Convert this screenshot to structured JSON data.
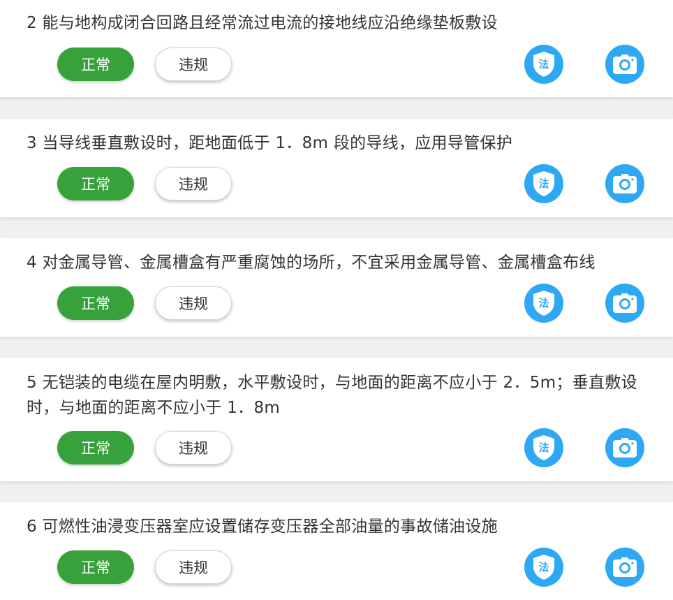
{
  "colors": {
    "normal_button": "#37a23b",
    "icon_button": "#2fa8f3",
    "background": "#f0f0f0"
  },
  "buttons": {
    "normal_label": "正常",
    "violation_label": "违规",
    "law_icon_char": "法"
  },
  "items": [
    {
      "text": "2 能与地构成闭合回路且经常流过电流的接地线应沿绝缘垫板敷设"
    },
    {
      "text": "3 当导线垂直敷设时，距地面低于 1．8m 段的导线，应用导管保护"
    },
    {
      "text": "4 对金属导管、金属槽盒有严重腐蚀的场所，不宜采用金属导管、金属槽盒布线"
    },
    {
      "text": "5 无铠装的电缆在屋内明敷，水平敷设时，与地面的距离不应小于 2．5m；垂直敷设时，与地面的距离不应小于 1．8m"
    },
    {
      "text": "6 可燃性油浸变压器室应设置储存变压器全部油量的事故储油设施"
    }
  ]
}
